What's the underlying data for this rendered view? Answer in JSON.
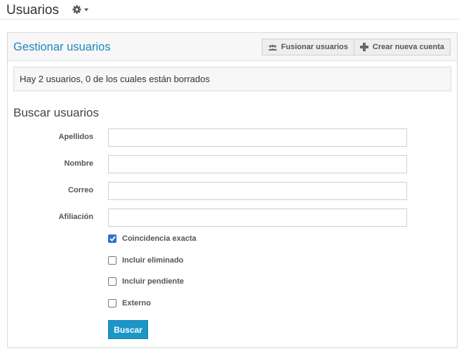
{
  "header": {
    "title": "Usuarios",
    "settings_icon": "gear-icon"
  },
  "panel": {
    "title": "Gestionar usuarios",
    "buttons": [
      {
        "label": "Fusionar usuarios",
        "icon": "merge-users-icon"
      },
      {
        "label": "Crear nueva cuenta",
        "icon": "plus-icon"
      }
    ],
    "info": "Hay 2 usuarios, 0 de los cuales están borrados"
  },
  "search": {
    "title": "Buscar usuarios",
    "fields": [
      {
        "label": "Apellidos",
        "value": ""
      },
      {
        "label": "Nombre",
        "value": ""
      },
      {
        "label": "Correo",
        "value": ""
      },
      {
        "label": "Afiliación",
        "value": ""
      }
    ],
    "options": [
      {
        "label": "Coincidencia exacta",
        "checked": true
      },
      {
        "label": "Incluir eliminado",
        "checked": false
      },
      {
        "label": "Incluir pendiente",
        "checked": false
      },
      {
        "label": "Externo",
        "checked": false
      }
    ],
    "submit_label": "Buscar"
  },
  "colors": {
    "accent": "#1f86c1",
    "button_primary": "#1a96c8",
    "checkbox_checked": "#2d73c8"
  }
}
